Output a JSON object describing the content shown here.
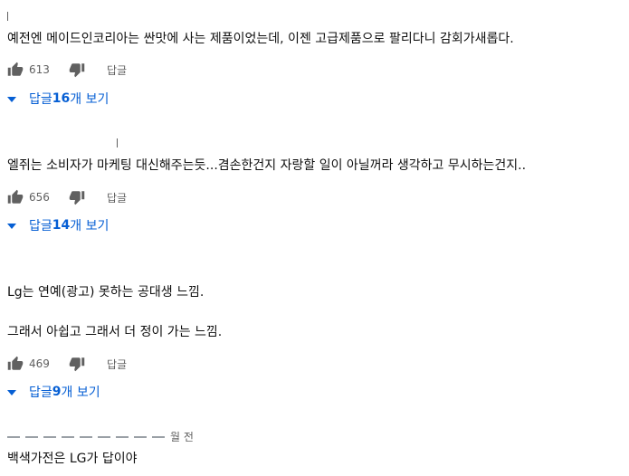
{
  "comments": [
    {
      "text": "예전엔 메이드인코리아는 싼맛에 사는 제품이었는데, 이젠 고급제품으로 팔리다니 감회가새롭다.",
      "likes": "613",
      "reply_label": "답글",
      "replies_prefix": "답글 ",
      "replies_count": "16",
      "replies_suffix": "개 보기"
    },
    {
      "text": "엘쥐는 소비자가 마케팅 대신해주는듯...겸손한건지 자랑할 일이 아닐꺼라 생각하고 무시하는건지..",
      "likes": "656",
      "reply_label": "답글",
      "replies_prefix": "답글 ",
      "replies_count": "14",
      "replies_suffix": "개 보기"
    },
    {
      "text_line1": "Lg는 연예(광고) 못하는 공대생 느낌.",
      "text_line2": "그래서 아쉽고 그래서 더 정이 가는 느낌.",
      "likes": "469",
      "reply_label": "답글",
      "replies_prefix": "답글 ",
      "replies_count": "9",
      "replies_suffix": "개 보기"
    },
    {
      "meta_suffix": "월 전",
      "text": "백색가전은 LG가 답이야"
    }
  ],
  "icons": {
    "like": "thumbs-up-icon",
    "dislike": "thumbs-down-icon",
    "expand": "caret-down-icon"
  },
  "colors": {
    "link": "#065fd4",
    "secondary": "#606060"
  }
}
